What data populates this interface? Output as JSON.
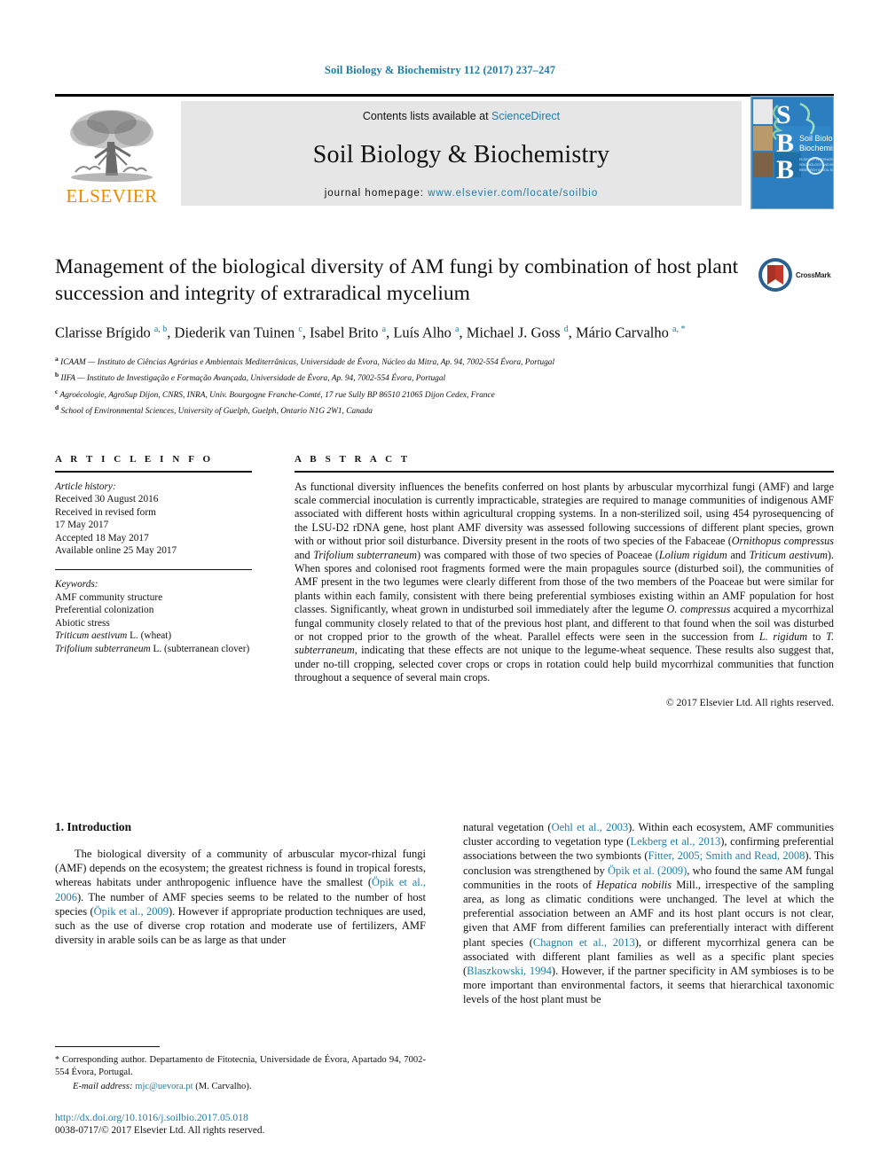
{
  "running_head": "Soil Biology & Biochemistry 112 (2017) 237–247",
  "masthead": {
    "publisher_name": "ELSEVIER",
    "contents_prefix": "Contents lists available at ",
    "contents_link": "ScienceDirect",
    "journal_name": "Soil Biology & Biochemistry",
    "homepage_prefix": "journal homepage: ",
    "homepage_url": "www.elsevier.com/locate/soilbio",
    "cover_letters": [
      "S",
      "B",
      "B"
    ],
    "cover_title_line1": "Soil Biology &",
    "cover_title_line2": "Biochemistry"
  },
  "article": {
    "title": "Management of the biological diversity of AM fungi by combination of host plant succession and integrity of extraradical mycelium",
    "crossmark_label": "CrossMark",
    "authors": [
      {
        "name": "Clarisse Brígido",
        "marks": "a, b",
        "sep": ", "
      },
      {
        "name": "Diederik van Tuinen",
        "marks": "c",
        "sep": ", "
      },
      {
        "name": "Isabel Brito",
        "marks": "a",
        "sep": ", "
      },
      {
        "name": "Luís Alho",
        "marks": "a",
        "sep": ", "
      },
      {
        "name": "Michael J. Goss",
        "marks": "d",
        "sep": ", "
      },
      {
        "name": "Mário Carvalho",
        "marks": "a, *",
        "sep": ""
      }
    ],
    "affiliations": [
      {
        "mark": "a",
        "text": "ICAAM — Instituto de Ciências Agrárias e Ambientais Mediterrânicas, Universidade de Évora, Núcleo da Mitra, Ap. 94, 7002-554 Évora, Portugal"
      },
      {
        "mark": "b",
        "text": "IIFA — Instituto de Investigação e Formação Avançada, Universidade de Évora, Ap. 94, 7002-554 Évora, Portugal"
      },
      {
        "mark": "c",
        "text": "Agroécologie, AgroSup Dijon, CNRS, INRA, Univ. Bourgogne Franche-Comté, 17 rue Sully BP 86510 21065 Dijon Cedex, France"
      },
      {
        "mark": "d",
        "text": "School of Environmental Sciences, University of Guelph, Guelph, Ontario N1G 2W1, Canada"
      }
    ]
  },
  "article_info": {
    "heading": "A R T I C L E   I N F O",
    "history_label": "Article history:",
    "history": [
      "Received 30 August 2016",
      "Received in revised form",
      "17 May 2017",
      "Accepted 18 May 2017",
      "Available online 25 May 2017"
    ],
    "keywords_label": "Keywords:",
    "keywords": [
      "AMF community structure",
      "Preferential colonization",
      "Abiotic stress"
    ],
    "keyword_italic_1_it": "Triticum aestivum",
    "keyword_italic_1_rest": " L. (wheat)",
    "keyword_italic_2_it": "Trifolium subterraneum",
    "keyword_italic_2_rest": " L. (subterranean clover)"
  },
  "abstract": {
    "heading": "A B S T R A C T",
    "p1": "As functional diversity influences the benefits conferred on host plants by arbuscular mycorrhizal fungi (AMF) and large scale commercial inoculation is currently impracticable, strategies are required to manage communities of indigenous AMF associated with different hosts within agricultural cropping systems. In a non-sterilized soil, using 454 pyrosequencing of the LSU-D2 rDNA gene, host plant AMF diversity was assessed following successions of different plant species, grown with or without prior soil disturbance. Diversity present in the roots of two species of the Fabaceae (",
    "it1": "Ornithopus compressus",
    "p2": " and ",
    "it2": "Trifolium subterraneum",
    "p3": ") was compared with those of two species of Poaceae (",
    "it3": "Lolium rigidum",
    "p4": " and ",
    "it4": "Triticum aestivum",
    "p5": "). When spores and colonised root fragments formed were the main propagules source (disturbed soil), the communities of AMF present in the two legumes were clearly different from those of the two members of the Poaceae but were similar for plants within each family, consistent with there being preferential symbioses existing within an AMF population for host classes. Significantly, wheat grown in undisturbed soil immediately after the legume ",
    "it5": "O. compressus",
    "p6": " acquired a mycorrhizal fungal community closely related to that of the previous host plant, and different to that found when the soil was disturbed or not cropped prior to the growth of the wheat. Parallel effects were seen in the succession from ",
    "it6": "L. rigidum",
    "p7": " to ",
    "it7": "T. subterraneum",
    "p8": ", indicating that these effects are not unique to the legume-wheat sequence. These results also suggest that, under no-till cropping, selected cover crops or crops in rotation could help build mycorrhizal communities that function throughout a sequence of several main crops.",
    "copyright": "© 2017 Elsevier Ltd. All rights reserved."
  },
  "introduction": {
    "heading": "1.  Introduction",
    "left_p1_a": "The biological diversity of a community of arbuscular mycor-rhizal fungi (AMF) depends on the ecosystem; the greatest richness is found in tropical forests, whereas habitats under anthropogenic influence have the smallest (",
    "left_cite1": "Öpik et al., 2006",
    "left_p1_b": "). The number of AMF species seems to be related to the number of host species (",
    "left_cite2": "Öpik et al., 2009",
    "left_p1_c": "). However if appropriate production techniques are used, such as the use of diverse crop rotation and moderate use of fertilizers, AMF diversity in arable soils can be as large as that under",
    "right_p1_a": "natural vegetation (",
    "right_cite1": "Oehl et al., 2003",
    "right_p1_b": "). Within each ecosystem, AMF communities cluster according to vegetation type (",
    "right_cite2": "Lekberg et al., 2013",
    "right_p1_c": "), confirming preferential associations between the two symbionts (",
    "right_cite3": "Fitter, 2005; Smith and Read, 2008",
    "right_p1_d": "). This conclusion was strengthened by ",
    "right_cite4": "Öpik et al. (2009)",
    "right_p1_e": ", who found the same AM fungal communities in the roots of ",
    "right_it1": "Hepatica nobilis",
    "right_p1_f": " Mill., irrespective of the sampling area, as long as climatic conditions were unchanged. The level at which the preferential association between an AMF and its host plant occurs is not clear, given that AMF from different families can preferentially interact with different plant species (",
    "right_cite5": "Chagnon et al., 2013",
    "right_p1_g": "), or different mycorrhizal genera can be associated with different plant families as well as a specific plant species (",
    "right_cite6": "Blaszkowski, 1994",
    "right_p1_h": "). However, if the partner specificity in AM symbioses is to be more important than environmental factors, it seems that hierarchical taxonomic levels of the host plant must be"
  },
  "footnote": {
    "star": "*",
    "text": " Corresponding author. Departamento de Fitotecnia, Universidade de Évora, Apartado 94, 7002-554 Évora, Portugal.",
    "email_label": "E-mail address:",
    "email": "mjc@uevora.pt",
    "email_suffix": " (M. Carvalho)."
  },
  "footer": {
    "doi": "http://dx.doi.org/10.1016/j.soilbio.2017.05.018",
    "issn": "0038-0717/© 2017 Elsevier Ltd. All rights reserved."
  },
  "colors": {
    "link_blue": "#1f7ca8",
    "elsevier_orange": "#ED8B00",
    "cover_blue": "#2b7fc1"
  }
}
